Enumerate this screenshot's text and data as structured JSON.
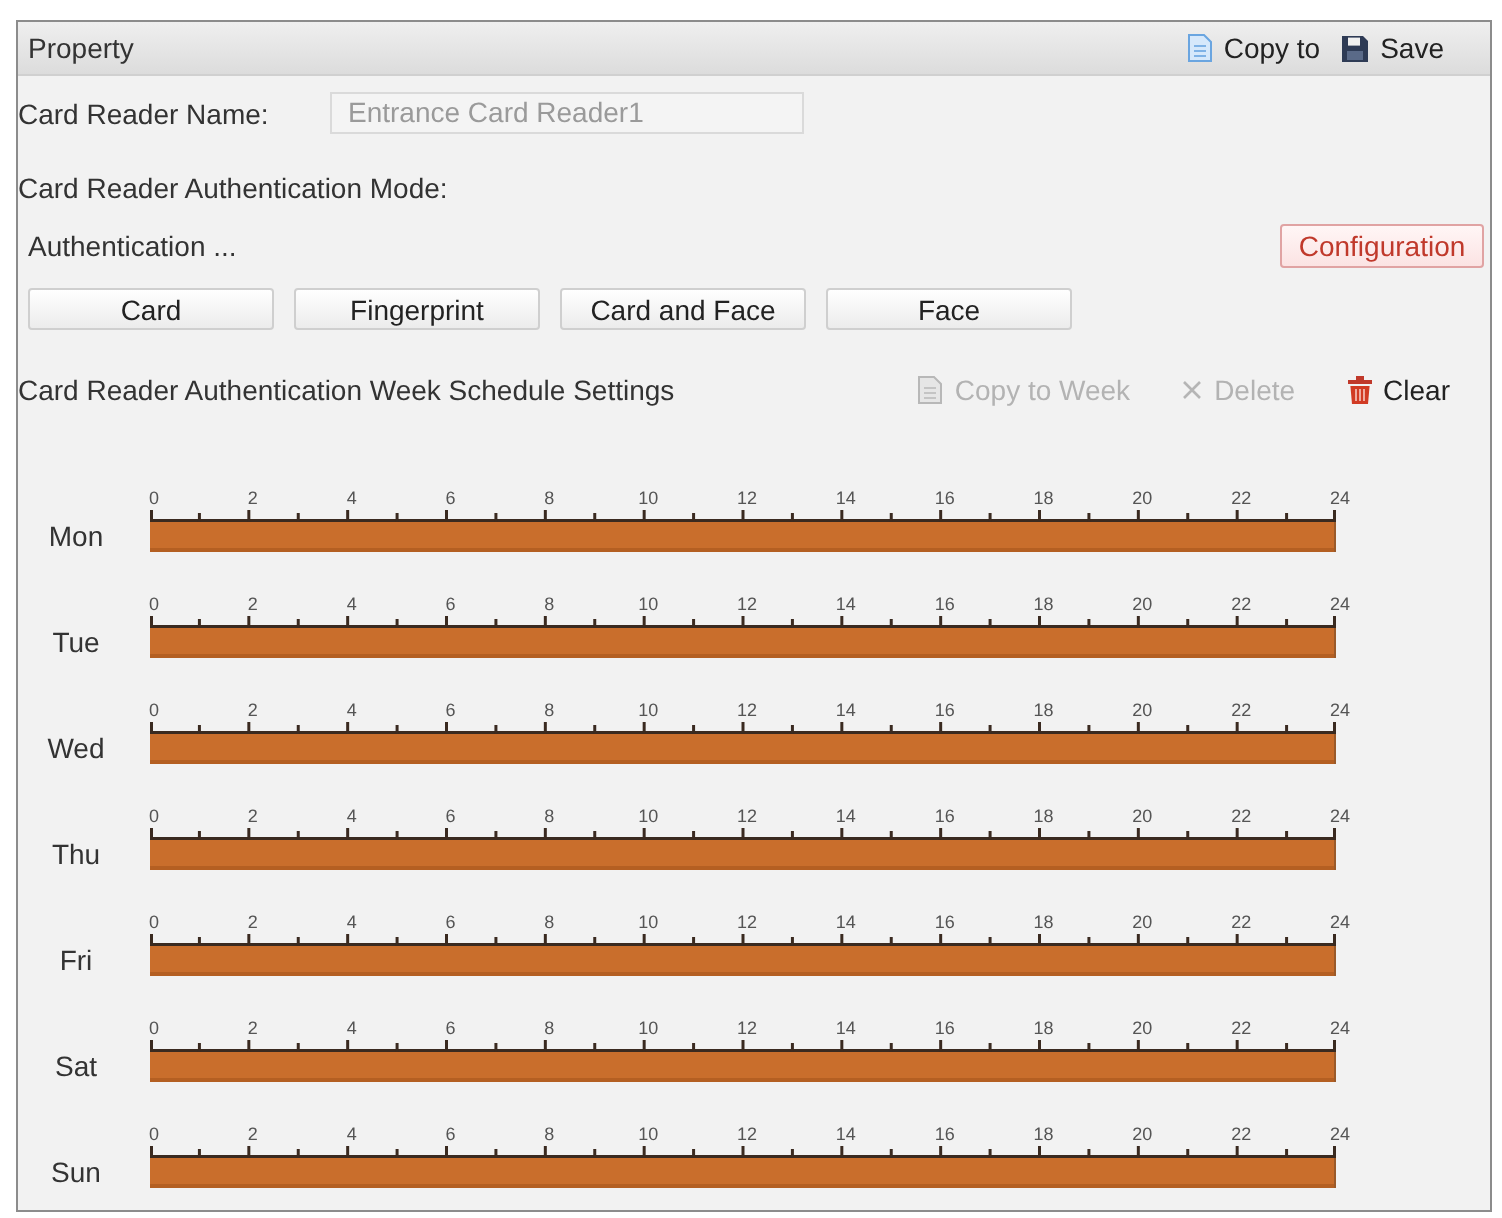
{
  "panel": {
    "title": "Property",
    "actions": [
      {
        "kind": "copy",
        "label": "Copy to"
      },
      {
        "kind": "save",
        "label": "Save"
      }
    ]
  },
  "reader_name": {
    "label": "Card Reader Name:",
    "value": "Entrance Card Reader1",
    "disabled": true
  },
  "auth_mode": {
    "label": "Card Reader Authentication Mode:",
    "summary": "Authentication ...",
    "configure_button": "Configuration",
    "modes": [
      {
        "label": "Card"
      },
      {
        "label": "Fingerprint"
      },
      {
        "label": "Card and Face"
      },
      {
        "label": "Face"
      }
    ]
  },
  "schedule": {
    "title": "Card Reader Authentication Week Schedule Settings",
    "actions": [
      {
        "kind": "copy",
        "label": "Copy to Week",
        "disabled": true
      },
      {
        "kind": "delete",
        "label": "Delete",
        "disabled": true
      },
      {
        "kind": "clear",
        "label": "Clear",
        "disabled": false
      }
    ],
    "days": [
      {
        "label": "Mon",
        "level": 1,
        "ticks": [
          "0",
          "2",
          "4",
          "6",
          "8",
          "10",
          "12",
          "14",
          "16",
          "18",
          "20",
          "22",
          "24"
        ]
      },
      {
        "label": "Tue",
        "level": 1,
        "ticks": [
          "0",
          "2",
          "4",
          "6",
          "8",
          "10",
          "12",
          "14",
          "16",
          "18",
          "20",
          "22",
          "24"
        ]
      },
      {
        "label": "Wed",
        "level": 1,
        "ticks": [
          "0",
          "2",
          "4",
          "6",
          "8",
          "10",
          "12",
          "14",
          "16",
          "18",
          "20",
          "22",
          "24"
        ]
      },
      {
        "label": "Thu",
        "level": 1,
        "ticks": [
          "0",
          "2",
          "4",
          "6",
          "8",
          "10",
          "12",
          "14",
          "16",
          "18",
          "20",
          "22",
          "24"
        ]
      },
      {
        "label": "Fri",
        "level": 1,
        "ticks": [
          "0",
          "2",
          "4",
          "6",
          "8",
          "10",
          "12",
          "14",
          "16",
          "18",
          "20",
          "22",
          "24"
        ]
      },
      {
        "label": "Sat",
        "level": 1,
        "ticks": [
          "0",
          "2",
          "4",
          "6",
          "8",
          "10",
          "12",
          "14",
          "16",
          "18",
          "20",
          "22",
          "24"
        ]
      },
      {
        "label": "Sun",
        "level": 1,
        "ticks": [
          "0",
          "2",
          "4",
          "6",
          "8",
          "10",
          "12",
          "14",
          "16",
          "18",
          "20",
          "22",
          "24"
        ]
      }
    ]
  }
}
